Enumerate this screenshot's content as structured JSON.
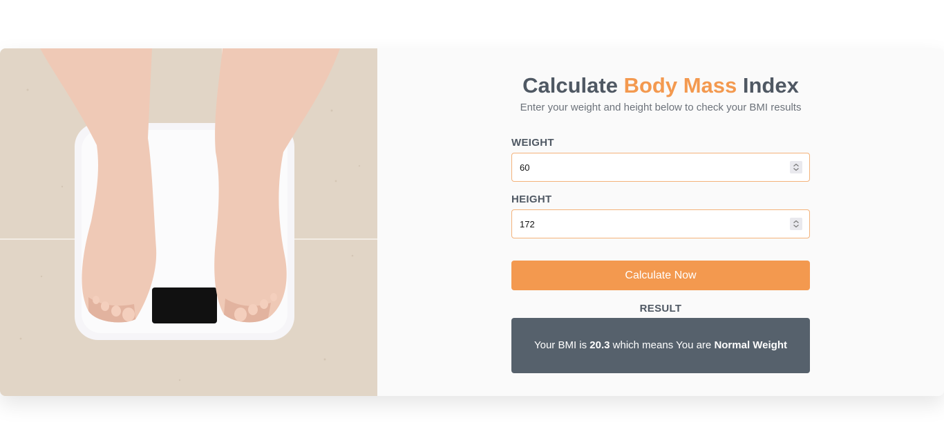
{
  "header": {
    "title_part1": "Calculate ",
    "title_accent": "Body Mass",
    "title_part2": " Index",
    "subtitle": "Enter your weight and height below to check your BMI results"
  },
  "form": {
    "weight_label": "WEIGHT",
    "weight_value": "60",
    "height_label": "HEIGHT",
    "height_value": "172",
    "calculate_label": "Calculate Now"
  },
  "result": {
    "label": "RESULT",
    "prefix": "Your BMI is ",
    "bmi_value": "20.3",
    "middle": " which means You are ",
    "category": "Normal Weight"
  },
  "colors": {
    "accent": "#f3994f",
    "heading": "#4f5863",
    "result_bg": "#56616c",
    "input_border": "#f3b27a"
  },
  "icons": {
    "spinner": "up-down-chevron-icon"
  }
}
